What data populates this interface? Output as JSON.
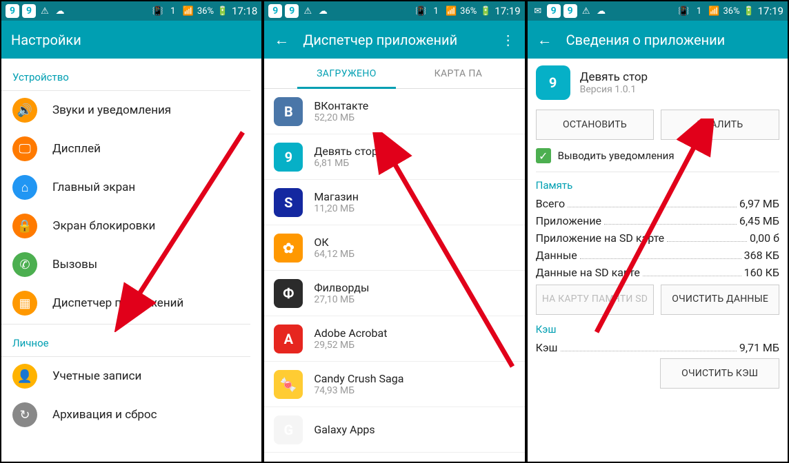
{
  "statusbar": {
    "nine_glyph": "9",
    "battery_pct": "36%",
    "time1": "17:18",
    "time2": "17:19",
    "time3": "17:19",
    "sim_label": "1"
  },
  "screen1": {
    "title": "Настройки",
    "section1": "Устройство",
    "items": [
      {
        "label": "Звуки и уведомления",
        "icon": "volume",
        "color": "#ff9800"
      },
      {
        "label": "Дисплей",
        "icon": "display",
        "color": "#ff7a00"
      },
      {
        "label": "Главный экран",
        "icon": "home",
        "color": "#2196f3"
      },
      {
        "label": "Экран блокировки",
        "icon": "lock",
        "color": "#ff7a00"
      },
      {
        "label": "Вызовы",
        "icon": "phone",
        "color": "#4caf50"
      },
      {
        "label": "Диспетчер приложений",
        "icon": "apps",
        "color": "#ff9800"
      }
    ],
    "section2": "Личное",
    "items2": [
      {
        "label": "Учетные записи",
        "icon": "person",
        "color": "#ffb300"
      },
      {
        "label": "Архивация и сброс",
        "icon": "backup",
        "color": "#888"
      }
    ]
  },
  "screen2": {
    "title": "Диспетчер приложений",
    "tab_active": "ЗАГРУЖЕНО",
    "tab_other": "КАРТА ПА",
    "apps": [
      {
        "name": "ВКонтакте",
        "size": "52,20 МБ",
        "bg": "#4a76a8",
        "letter": "B"
      },
      {
        "name": "Девять стор",
        "size": "6,81 МБ",
        "bg": "#06b0c7",
        "letter": "9"
      },
      {
        "name": "Магазин",
        "size": "11,20 МБ",
        "bg": "#1428a0",
        "letter": "S"
      },
      {
        "name": "ОК",
        "size": "64,12 МБ",
        "bg": "#ff9800",
        "letter": "✿"
      },
      {
        "name": "Филворды",
        "size": "27,10 МБ",
        "bg": "#2b2b2b",
        "letter": "Ф"
      },
      {
        "name": "Adobe Acrobat",
        "size": "29,52 МБ",
        "bg": "#e6261f",
        "letter": "A"
      },
      {
        "name": "Candy Crush Saga",
        "size": "74,93 МБ",
        "bg": "#ffcc33",
        "letter": "🍬"
      },
      {
        "name": "Galaxy Apps",
        "size": "",
        "bg": "#f5f5f5",
        "letter": "G"
      }
    ]
  },
  "screen3": {
    "title": "Сведения о приложении",
    "app_name": "Девять стор",
    "app_version": "Версия 1.0.1",
    "btn_stop": "ОСТАНОВИТЬ",
    "btn_delete": "УДАЛИТЬ",
    "checkbox_label": "Выводить уведомления",
    "section_memory": "Память",
    "mem": [
      {
        "k": "Всего",
        "v": "6,97 МБ"
      },
      {
        "k": "Приложение",
        "v": "6,45 МБ"
      },
      {
        "k": "Приложение на SD карте",
        "v": "0,00 б"
      },
      {
        "k": "Данные",
        "v": "368 КБ"
      },
      {
        "k": "Данные на SD карте",
        "v": "160 КБ"
      }
    ],
    "btn_sd": "НА КАРТУ ПАМЯТИ SD",
    "btn_clear_data": "ОЧИСТИТЬ ДАННЫЕ",
    "section_cache": "Кэш",
    "cache_label": "Кэш",
    "cache_value": "9,71 МБ",
    "btn_clear_cache": "ОЧИСТИТЬ КЭШ"
  }
}
